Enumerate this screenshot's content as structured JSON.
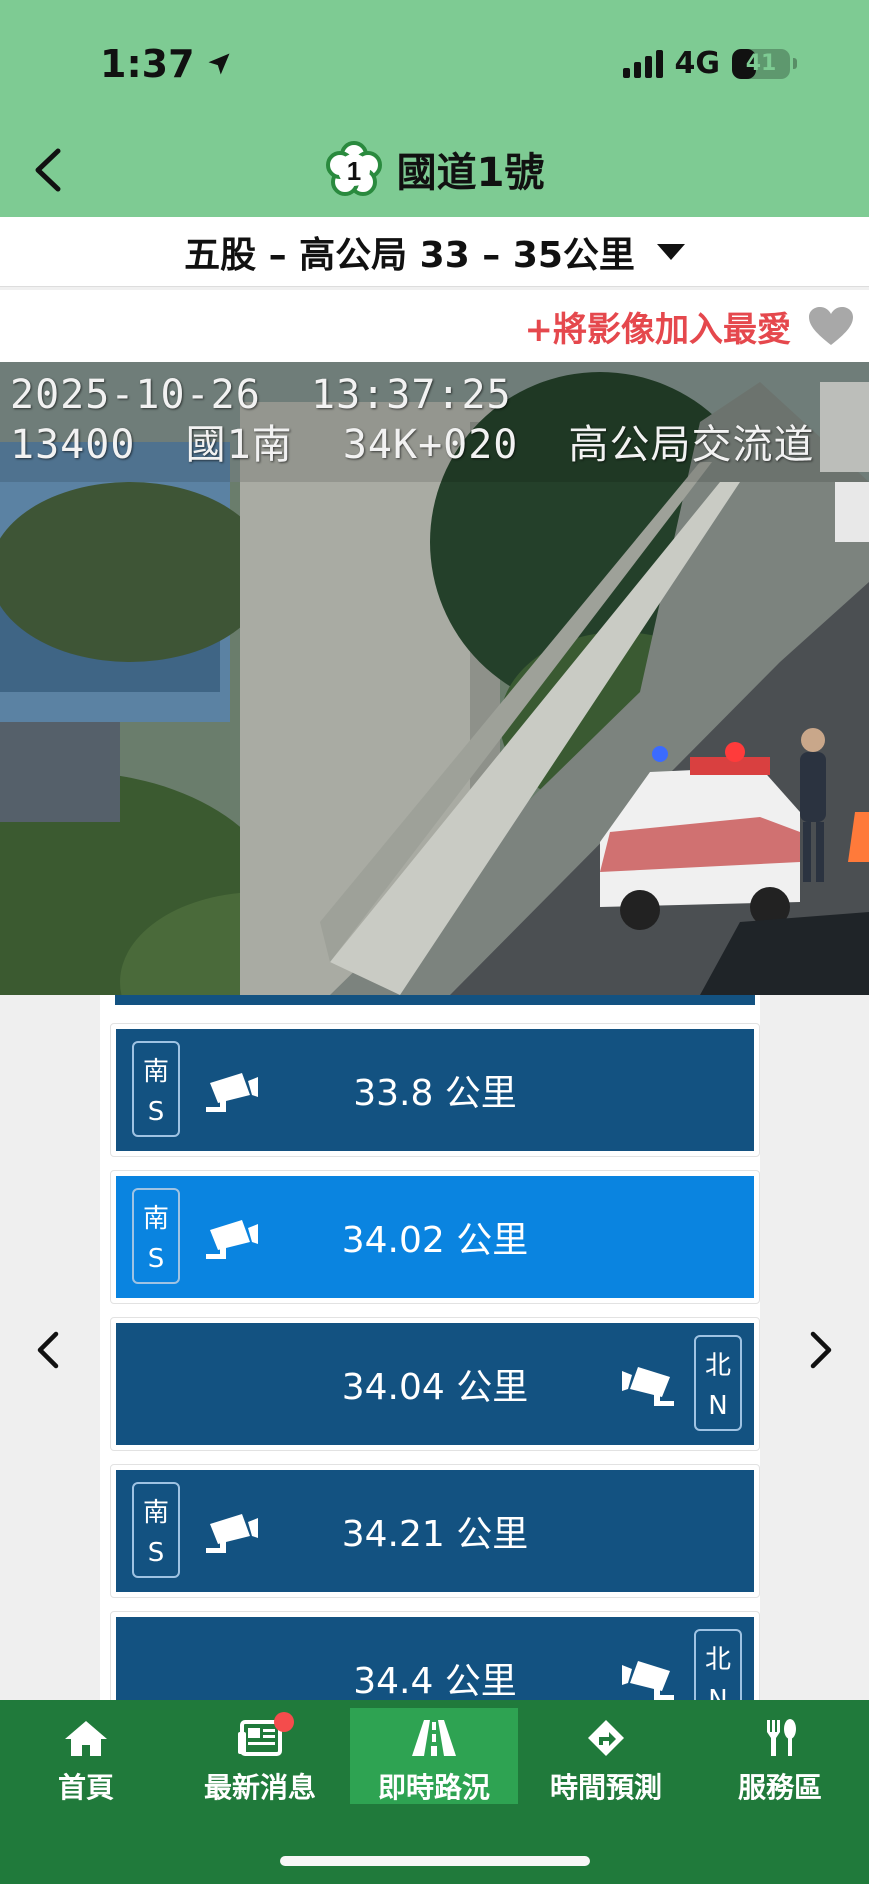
{
  "status_bar": {
    "time": "1:37",
    "network": "4G",
    "battery": "41",
    "battery_level": 0.41
  },
  "header": {
    "title": "國道1號",
    "route_number": "1"
  },
  "segment": {
    "label": "五股 – 高公局 33 – 35公里"
  },
  "favorite": {
    "label": "+將影像加入最愛"
  },
  "camera_feed": {
    "timestamp": "2025-10-26  13:37:25",
    "location": "13400  國1南  34K+020  高公局交流道"
  },
  "camera_list": [
    {
      "km": "33.8 公里",
      "direction_zh": "南",
      "direction_en": "S",
      "side": "left",
      "active": false
    },
    {
      "km": "34.02 公里",
      "direction_zh": "南",
      "direction_en": "S",
      "side": "left",
      "active": true
    },
    {
      "km": "34.04 公里",
      "direction_zh": "北",
      "direction_en": "N",
      "side": "right",
      "active": false
    },
    {
      "km": "34.21 公里",
      "direction_zh": "南",
      "direction_en": "S",
      "side": "left",
      "active": false
    },
    {
      "km": "34.4 公里",
      "direction_zh": "北",
      "direction_en": "N",
      "side": "right",
      "active": false
    }
  ],
  "tabs": [
    {
      "label": "首頁",
      "icon": "home-icon",
      "active": false
    },
    {
      "label": "最新消息",
      "icon": "news-icon",
      "active": false
    },
    {
      "label": "即時路況",
      "icon": "road-icon",
      "active": true
    },
    {
      "label": "時間預測",
      "icon": "route-icon",
      "active": false
    },
    {
      "label": "服務區",
      "icon": "dining-icon",
      "active": false
    }
  ],
  "colors": {
    "header_green": "#7ecb93",
    "tab_green": "#207a3b",
    "item_blue": "#135281",
    "active_blue": "#0a84e0",
    "favorite_red": "#e5484d"
  }
}
